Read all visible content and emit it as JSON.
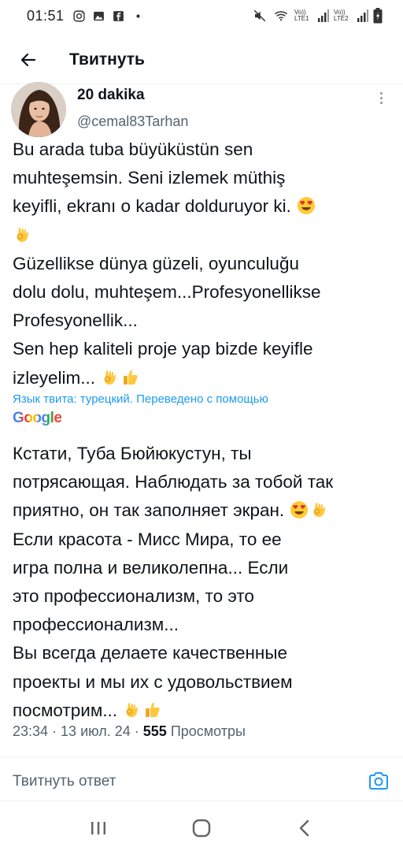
{
  "status_bar": {
    "time": "01:51",
    "signal_label_1": "Vo)) LTE1",
    "signal_label_2": "Vo)) LTE2"
  },
  "header": {
    "title": "Твитнуть"
  },
  "tweet": {
    "author_name": "20 dakika",
    "author_handle": "@cemal83Tarhan",
    "original_lines": [
      "Bu arada tuba büyüküstün sen",
      "muhteşemsin. Seni izlemek müthiş",
      "keyifli, ekranı o kadar dolduruyor ki.",
      "Güzellikse dünya güzeli, oyunculuğu",
      "dolu dolu, muhteşem...Profesyonellikse",
      "Profesyonellik...",
      "Sen hep kaliteli proje yap bizde keyifle",
      "izleyelim..."
    ],
    "translation_note": "Язык твита: турецкий. Переведено с помощью",
    "google_label": "Google",
    "translated_lines": [
      "Кстати, Туба Бюйюкустун, ты",
      "потрясающая. Наблюдать за тобой так",
      "приятно, он так заполняет экран.",
      "Если красота - Мисс Мира, то ее",
      "игра полна и великолепна... Если",
      "это профессионализм, то это",
      "профессионализм...",
      "Вы всегда делаете качественные",
      "проекты и мы их с удовольствием",
      "посмотрим..."
    ],
    "time": "23:34",
    "date": "13 июл. 24",
    "views_count": "555",
    "views_label": "Просмотры"
  },
  "reply": {
    "placeholder": "Твитнуть ответ"
  },
  "icons": {
    "back": "arrow-left-icon",
    "more": "more-vertical-icon",
    "camera": "camera-icon",
    "emoji_heart_eyes": "heart-eyes-emoji",
    "emoji_ok": "ok-hand-emoji",
    "emoji_thumbs": "thumbs-up-emoji"
  },
  "colors": {
    "accent": "#1d9bf0",
    "text_primary": "#0f1419",
    "text_secondary": "#536471"
  }
}
